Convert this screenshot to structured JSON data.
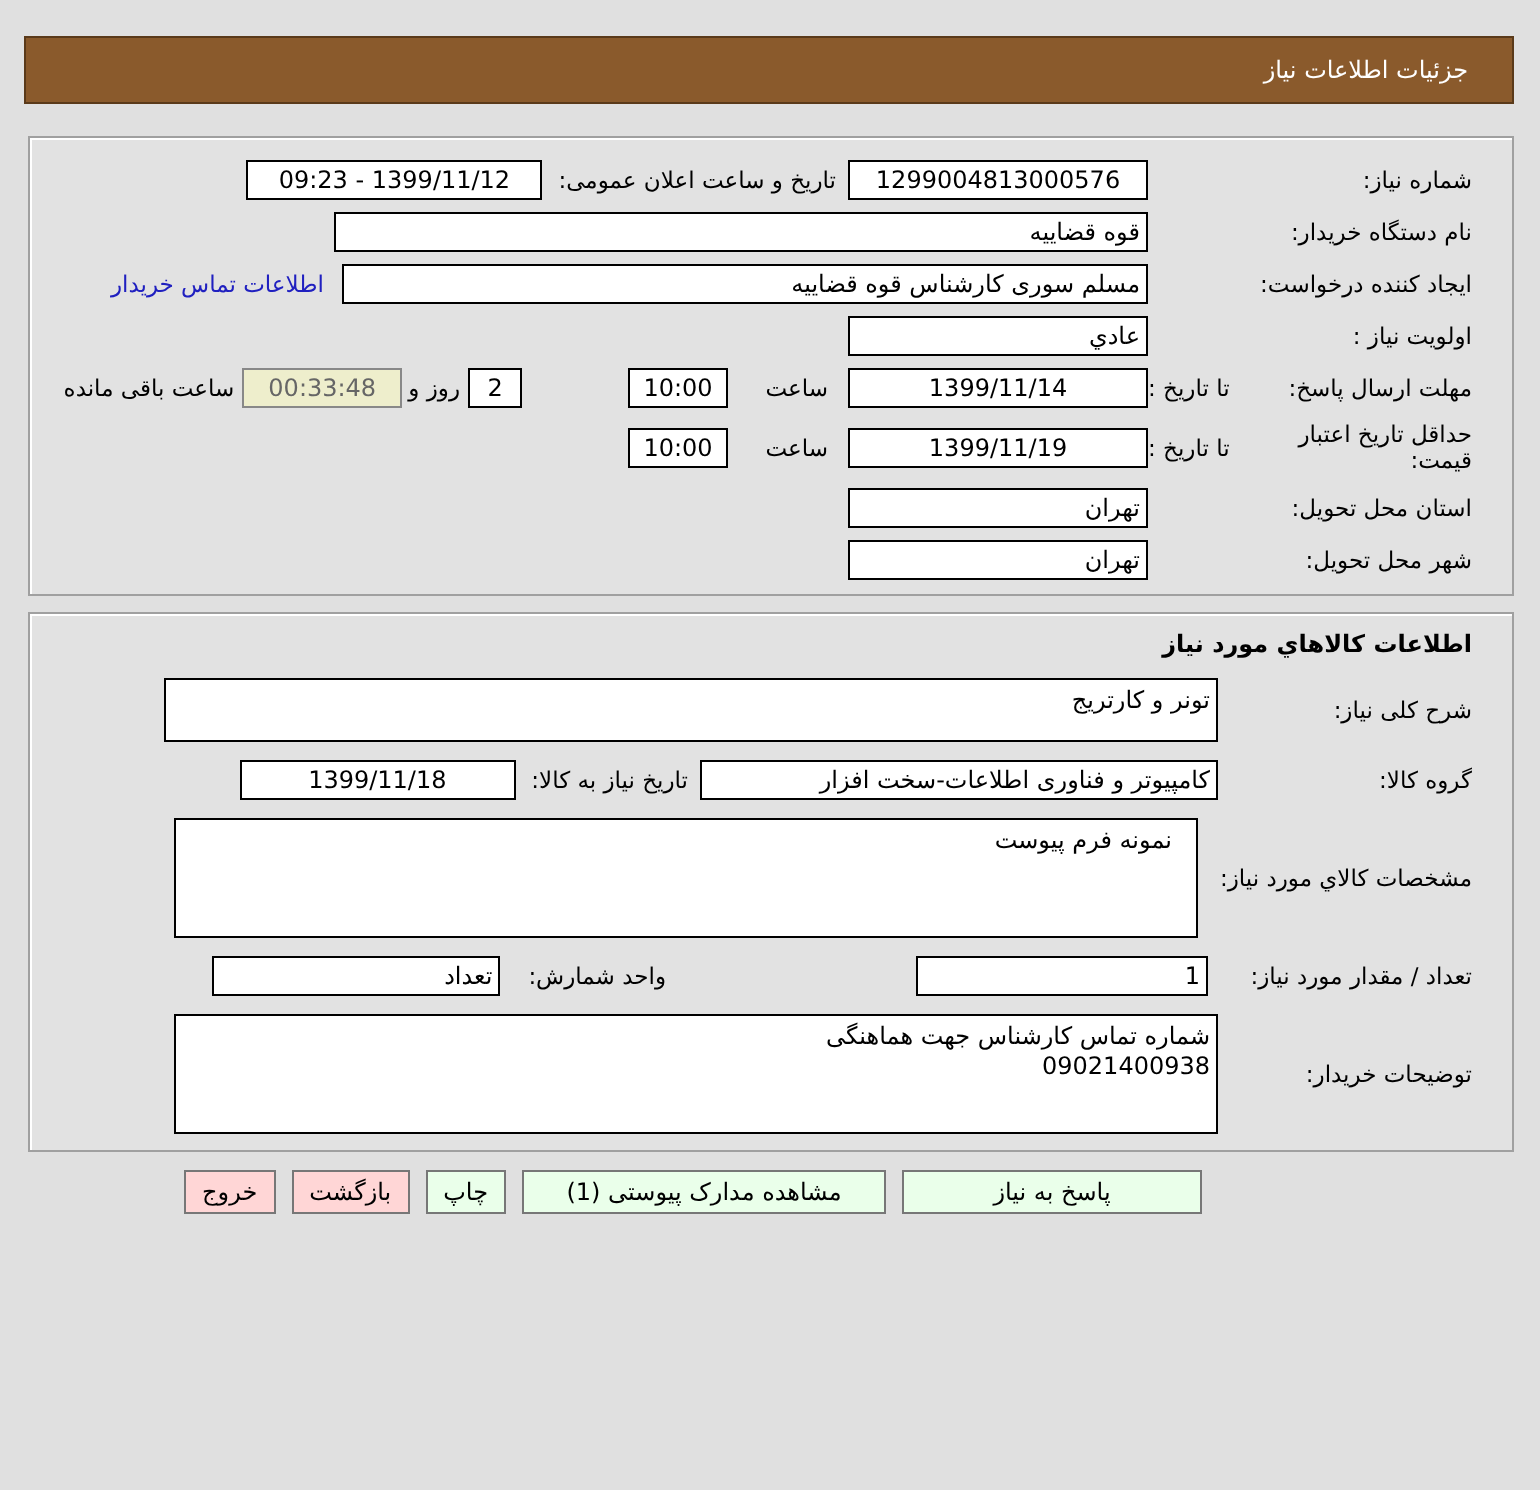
{
  "header": {
    "title": "جزئیات اطلاعات نیاز"
  },
  "need": {
    "need_number_label": "شماره نیاز:",
    "need_number": "1299004813000576",
    "announce_label": "تاریخ و ساعت اعلان عمومی:",
    "announce_value": "1399/11/12 - 09:23",
    "buyer_label": "نام دستگاه خریدار:",
    "buyer": "قوه قضاییه",
    "creator_label": "ایجاد کننده درخواست:",
    "creator": "مسلم سوری کارشناس قوه قضاییه",
    "contact_link": "اطلاعات تماس خریدار",
    "priority_label": "اولویت نیاز :",
    "priority": "عادي",
    "deadline_label": "مهلت ارسال پاسخ:",
    "deadline_to_label": "تا تاریخ :",
    "deadline_date": "1399/11/14",
    "deadline_time_label": "ساعت",
    "deadline_time": "10:00",
    "days": "2",
    "days_label": "روز و",
    "remaining": "00:33:48",
    "remaining_label": "ساعت باقی مانده",
    "validity_label": "حداقل تاریخ اعتبار قیمت:",
    "validity_to_label": "تا تاریخ :",
    "validity_date": "1399/11/19",
    "validity_time_label": "ساعت",
    "validity_time": "10:00",
    "province_label": "استان محل تحویل:",
    "province": "تهران",
    "city_label": "شهر محل تحویل:",
    "city": "تهران"
  },
  "goods": {
    "title": "اطلاعات کالاهاي مورد نياز",
    "summary_label": "شرح کلی نیاز:",
    "summary": "تونر و کارتریج",
    "group_label": "گروه کالا:",
    "group": "کامپیوتر و فناوری اطلاعات-سخت افزار",
    "need_date_label": "تاریخ نیاز به کالا:",
    "need_date": "1399/11/18",
    "spec_label": "مشخصات کالاي مورد نياز:",
    "spec": "نمونه فرم پیوست",
    "qty_label": "تعداد / مقدار مورد نیاز:",
    "qty": "1",
    "unit_label": "واحد شمارش:",
    "unit": "تعداد",
    "notes_label": "توضیحات خریدار:",
    "notes": [
      "شماره تماس کارشناس جهت هماهنگی",
      "09021400938"
    ]
  },
  "buttons": [
    {
      "label": "پاسخ به نیاز",
      "kind": "green"
    },
    {
      "label": "مشاهده مدارک پیوستی (1)",
      "kind": "green"
    },
    {
      "label": "چاپ",
      "kind": "green"
    },
    {
      "label": "بازگشت",
      "kind": "pink"
    },
    {
      "label": "خروج",
      "kind": "pink"
    }
  ]
}
